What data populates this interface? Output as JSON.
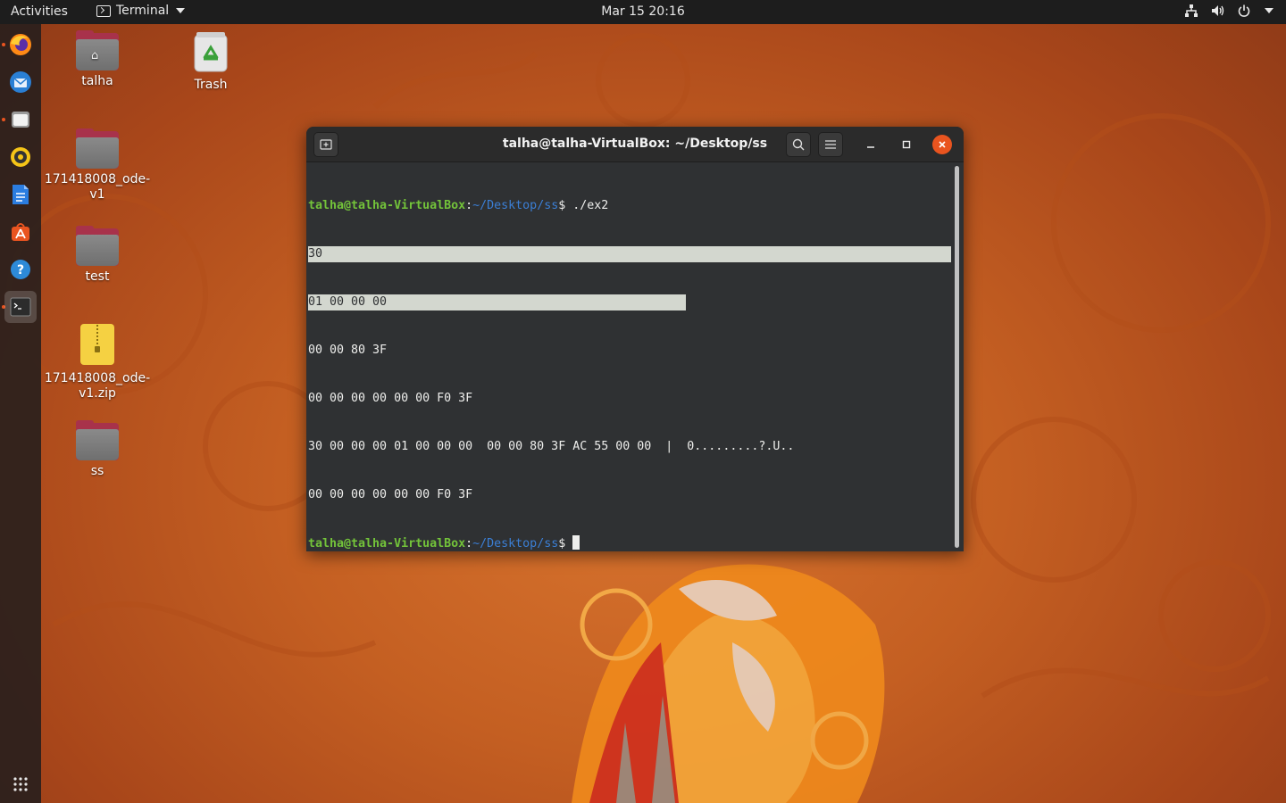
{
  "topbar": {
    "activities": "Activities",
    "app_name": "Terminal",
    "clock": "Mar 15  20:16"
  },
  "dock": {
    "items": [
      {
        "name": "firefox",
        "icon": "firefox-icon"
      },
      {
        "name": "thunderbird",
        "icon": "thunderbird-icon"
      },
      {
        "name": "files",
        "icon": "files-icon"
      },
      {
        "name": "rhythmbox",
        "icon": "rhythmbox-icon"
      },
      {
        "name": "libreoffice-writer",
        "icon": "writer-icon"
      },
      {
        "name": "ubuntu-software",
        "icon": "software-icon"
      },
      {
        "name": "help",
        "icon": "help-icon"
      },
      {
        "name": "terminal",
        "icon": "terminal-icon"
      }
    ],
    "show_apps_icon": "grid-icon"
  },
  "desktop": {
    "icons": [
      {
        "label": "talha",
        "type": "home-folder"
      },
      {
        "label": "Trash",
        "type": "trash"
      },
      {
        "label": "171418008_ode-v1",
        "type": "folder"
      },
      {
        "label": "test",
        "type": "folder"
      },
      {
        "label": "171418008_ode-v1.zip",
        "type": "zip"
      },
      {
        "label": "ss",
        "type": "folder"
      }
    ]
  },
  "terminal": {
    "title": "talha@talha-VirtualBox: ~/Desktop/ss",
    "prompt_user": "talha@talha-VirtualBox",
    "prompt_sep": ":",
    "prompt_path": "~/Desktop/ss",
    "prompt_dollar": "$ ",
    "command": "./ex2",
    "output": [
      "30",
      "01 00 00 00",
      "00 00 80 3F",
      "00 00 00 00 00 00 F0 3F",
      "30 00 00 00 01 00 00 00  00 00 80 3F AC 55 00 00  |  0.........?.U..",
      "00 00 00 00 00 00 F0 3F"
    ]
  },
  "colors": {
    "accent": "#e95420",
    "terminal_bg": "#2f3133",
    "prompt_user": "#73c33a",
    "prompt_path": "#3b7fd6"
  }
}
